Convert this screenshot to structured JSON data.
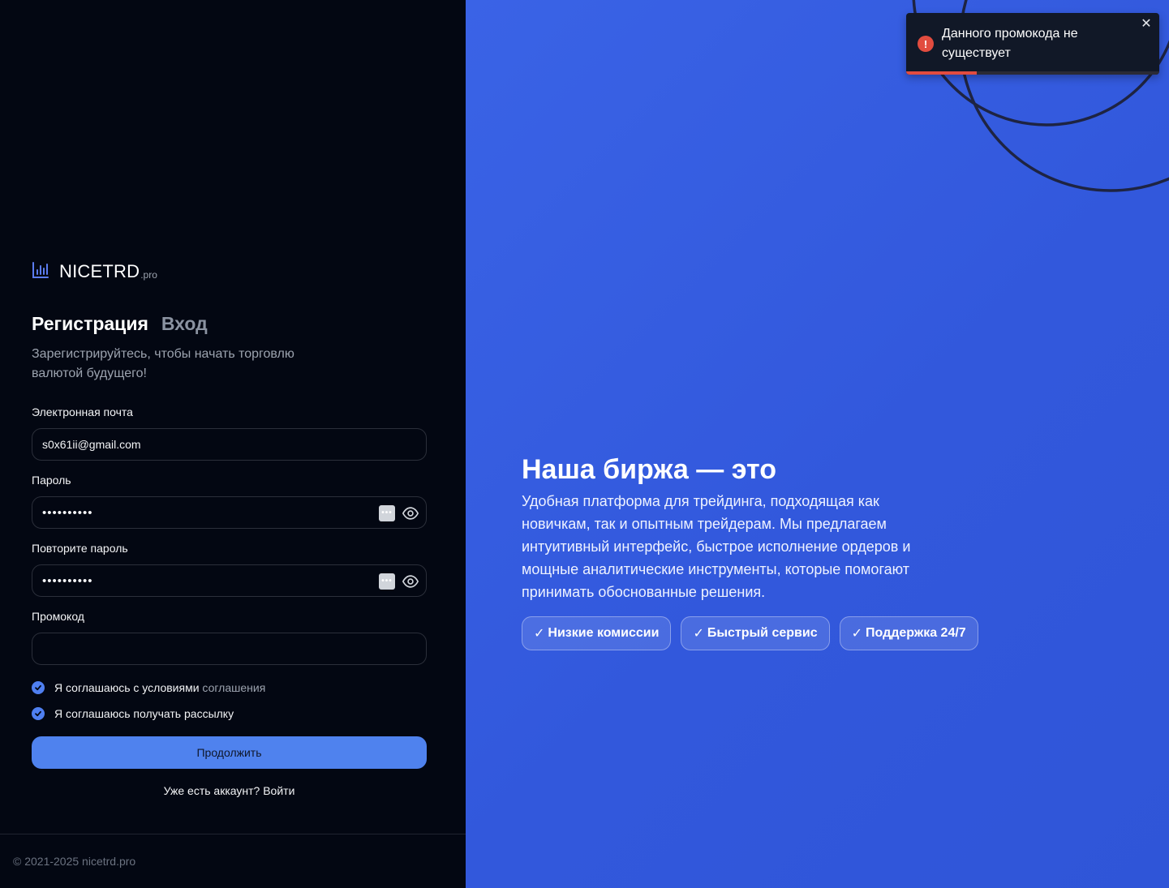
{
  "brand": {
    "name": "NICETRD",
    "suffix": ".pro"
  },
  "auth_tabs": {
    "register": "Регистрация",
    "login": "Вход"
  },
  "subtitle": "Зарегистрируйтесь, чтобы начать торговлю валютой будущего!",
  "form": {
    "email_label": "Электронная почта",
    "email_value": "s0x61ii@gmail.com",
    "password_label": "Пароль",
    "password_value": "••••••••••",
    "repeat_label": "Повторите пароль",
    "repeat_value": "••••••••••",
    "promo_label": "Промокод",
    "promo_value": "",
    "agree_terms_prefix": "Я соглашаюсь с условиями",
    "agree_terms_link": "соглашения",
    "agree_mailing": "Я соглашаюсь получать рассылку",
    "submit_label": "Продолжить",
    "login_prompt": "Уже есть аккаунт? Войти"
  },
  "footer": {
    "copyright": "© 2021-2025 nicetrd.pro"
  },
  "hero": {
    "title": "Наша биржа — это",
    "text": "Удобная платформа для трейдинга, подходящая как новичкам, так и опытным трейдерам. Мы предлагаем интуитивный интерфейс, быстрое исполнение ордеров и мощные аналитические инструменты, которые помогают принимать обоснованные решения.",
    "badges": [
      "Низкие комиссии",
      "Быстрый сервис",
      "Поддержка 24/7"
    ]
  },
  "toast": {
    "message": "Данного промокода не существует",
    "progress": 0.28,
    "type": "error"
  },
  "colors": {
    "accent": "#4f82ee",
    "hero_bg": "#3258dc",
    "error": "#e24c3f"
  },
  "icons": {
    "logo": "bar-chart-icon",
    "password_manager": "password-manager-icon",
    "visibility": "eye-icon",
    "close": "close-icon",
    "error": "exclamation-icon"
  }
}
